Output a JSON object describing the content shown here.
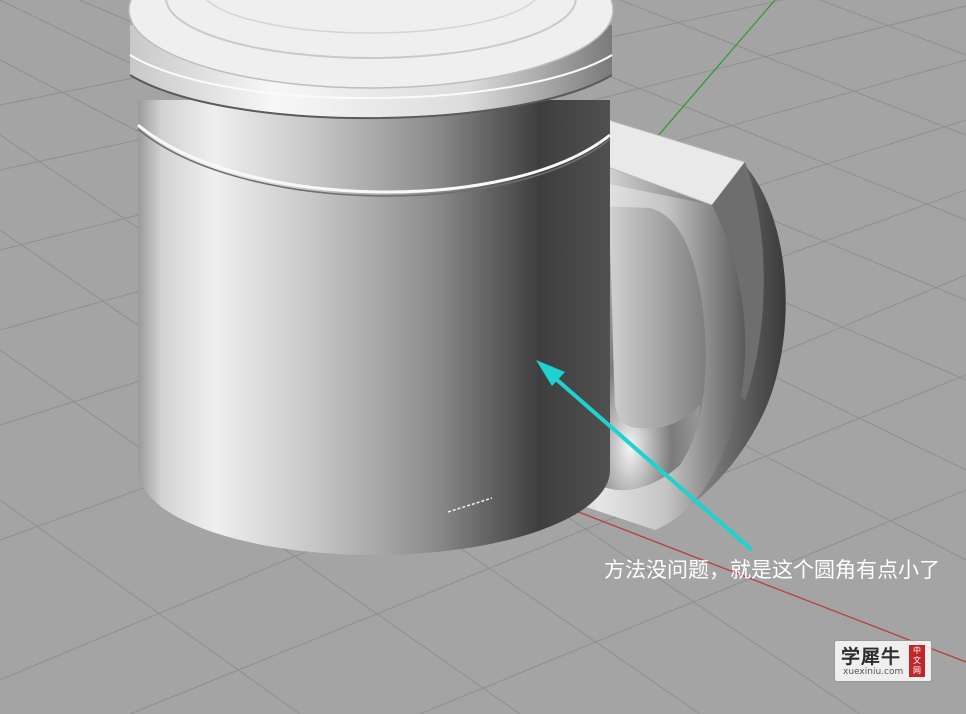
{
  "scene": {
    "background_color": "#a4a4a4",
    "grid_color": "#8f8f8f",
    "x_axis_color": "#b5423a",
    "y_axis_color": "#2e9e2e",
    "arrow_color": "#1fd2d2"
  },
  "annotation": {
    "text": "方法没问题，就是这个圆角有点小了"
  },
  "watermark": {
    "title": "学犀牛",
    "domain": "xuexiniu.com",
    "seal": [
      "中",
      "文",
      "网"
    ]
  }
}
